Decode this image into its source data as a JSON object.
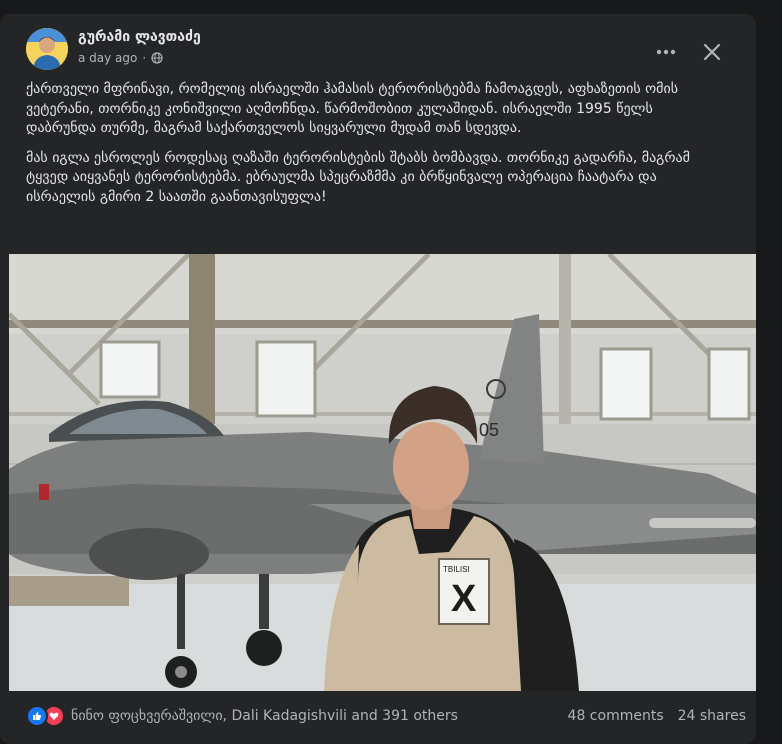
{
  "post": {
    "author": "გურამი ლავთაძე",
    "time": "a day ago",
    "privacy_icon": "globe-icon",
    "paragraphs": [
      "ქართველი მფრინავი, რომელიც ისრაელში ჰამასის ტერორისტებმა ჩამოაგდეს, აფხაზეთის ომის ვეტერანი, თორნიკე კონიშვილი აღმოჩნდა. წარმოშობით კულაშიდან. ისრაელში 1995 წელს დაბრუნდა თურმე, მაგრამ საქართველოს სიყვარული მუდამ თან სდევდა.",
      "მას იგლა ესროლეს როდესაც ღაზაში ტერორისტების შტაბს ბომბავდა. თორნიკე გადარჩა, მაგრამ ტყვედ აიყვანეს ტერორისტებმა. ებრაულმა სპეცრაზმმა კი ბრწყინვალე ოპერაცია ჩაატარა და ისრაელის გმირი 2 საათში გაანთავისუფლა!"
    ]
  },
  "photo": {
    "tail_number": "05",
    "vest_badge_top": "TBILISI",
    "vest_badge_letter": "X"
  },
  "footer": {
    "reacted": "ნინო ფოცხვერაშვილი, Dali Kadagishvili and 391 others",
    "comments": "48 comments",
    "shares": "24 shares"
  },
  "colors": {
    "card": "#242526",
    "like": "#1877f2",
    "love": "#f33e58"
  }
}
